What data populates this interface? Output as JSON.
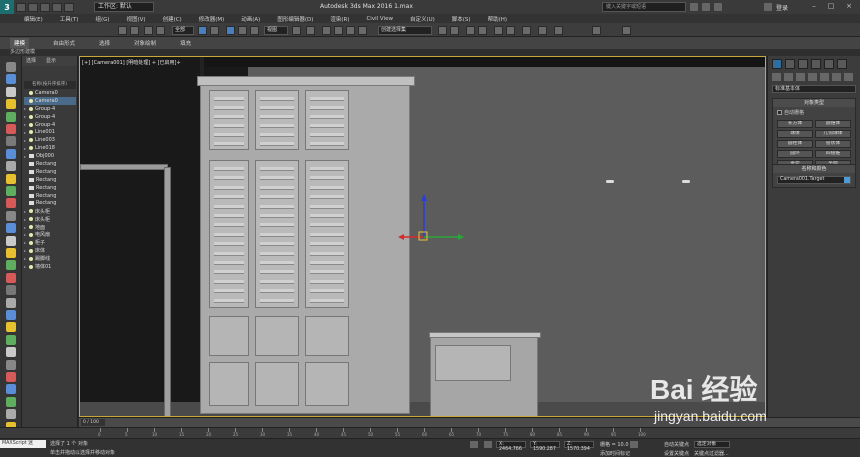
{
  "titlebar": {
    "workspace": "工作区: 默认",
    "title": "Autodesk 3ds Max 2016    1.max",
    "search_placeholder": "键入关键字或短语",
    "login": "登录"
  },
  "menu": [
    "编辑(E)",
    "工具(T)",
    "组(G)",
    "视图(V)",
    "创建(C)",
    "修改器(M)",
    "动画(A)",
    "图形编辑器(D)",
    "渲染(R)",
    "Civil View",
    "自定义(U)",
    "脚本(S)",
    "帮助(H)"
  ],
  "toolbar": {
    "filter": "全部",
    "view": "视图",
    "named_set": "创建选择集"
  },
  "ribbon": {
    "tabs": [
      "建模",
      "自由形式",
      "选择",
      "对象绘制",
      "填充"
    ],
    "sub_label": "多边形建模"
  },
  "explorer": {
    "tabs": [
      "选择",
      "显示"
    ],
    "header": "名称(按升序排序)",
    "items": [
      {
        "label": "Camera0",
        "type": "bulb",
        "expand": false,
        "selected": false
      },
      {
        "label": "Camera0",
        "type": "bulb",
        "expand": false,
        "selected": true
      },
      {
        "label": "Group-4",
        "type": "bulb",
        "expand": true,
        "selected": false
      },
      {
        "label": "Group-4",
        "type": "bulb",
        "expand": true,
        "selected": false
      },
      {
        "label": "Group-4",
        "type": "bulb",
        "expand": true,
        "selected": false
      },
      {
        "label": "Line001",
        "type": "bulb",
        "expand": true,
        "selected": false
      },
      {
        "label": "Line003",
        "type": "bulb",
        "expand": true,
        "selected": false
      },
      {
        "label": "Line018",
        "type": "bulb",
        "expand": true,
        "selected": false
      },
      {
        "label": "Obj000",
        "type": "obj",
        "expand": true,
        "selected": false
      },
      {
        "label": "Rectang",
        "type": "obj",
        "expand": false,
        "selected": false
      },
      {
        "label": "Rectang",
        "type": "obj",
        "expand": false,
        "selected": false
      },
      {
        "label": "Rectang",
        "type": "obj",
        "expand": false,
        "selected": false
      },
      {
        "label": "Rectang",
        "type": "obj",
        "expand": false,
        "selected": false
      },
      {
        "label": "Rectang",
        "type": "obj",
        "expand": false,
        "selected": false
      },
      {
        "label": "Rectang",
        "type": "obj",
        "expand": false,
        "selected": false
      },
      {
        "label": "床头柜",
        "type": "bulb",
        "expand": true,
        "selected": false
      },
      {
        "label": "床头柜",
        "type": "bulb",
        "expand": true,
        "selected": false
      },
      {
        "label": "地面",
        "type": "bulb",
        "expand": true,
        "selected": false
      },
      {
        "label": "电风扇",
        "type": "bulb",
        "expand": true,
        "selected": false
      },
      {
        "label": "柜子",
        "type": "bulb",
        "expand": true,
        "selected": false
      },
      {
        "label": "床体",
        "type": "bulb",
        "expand": true,
        "selected": false
      },
      {
        "label": "踢脚线",
        "type": "bulb",
        "expand": true,
        "selected": false
      },
      {
        "label": "墙体01",
        "type": "bulb",
        "expand": true,
        "selected": false
      }
    ]
  },
  "viewport": {
    "label": "[+] [Camera001] [明暗处理] + [已启用]+"
  },
  "command_panel": {
    "category": "标准基本体",
    "object_type_title": "对象类型",
    "autogrid": "自动栅格",
    "buttons": [
      "长方体",
      "圆锥体",
      "球体",
      "几何球体",
      "圆柱体",
      "管状体",
      "圆环",
      "四棱锥",
      "茶壶",
      "平面"
    ],
    "name_color_title": "名称和颜色",
    "name_value": "Camera001.Target",
    "swatch_color": "#4d9bd6"
  },
  "timeline": {
    "frame": "0 / 100"
  },
  "track_ticks": [
    "0",
    "5",
    "10",
    "15",
    "20",
    "25",
    "30",
    "35",
    "40",
    "45",
    "50",
    "55",
    "60",
    "65",
    "70",
    "75",
    "80",
    "85",
    "90",
    "95",
    "100"
  ],
  "status": {
    "maxscript": "MAXScript 迷",
    "selected": "选择了 1 个 对象",
    "prompt": "单击并拖动以选择并移动对象",
    "x": "X: 2464.766",
    "y": "Y: 1590.287",
    "z": "Z: 1570.394",
    "grid": "栅格 = 10.0",
    "auto_key": "自动关键点",
    "selected_obj": "选定对象",
    "set_key": "设置关键点",
    "key_filter": "关键点过滤器...",
    "add_time_tag": "添加时间标记"
  },
  "watermark": {
    "text": "Bai 经验",
    "url": "jingyan.baidu.com"
  }
}
